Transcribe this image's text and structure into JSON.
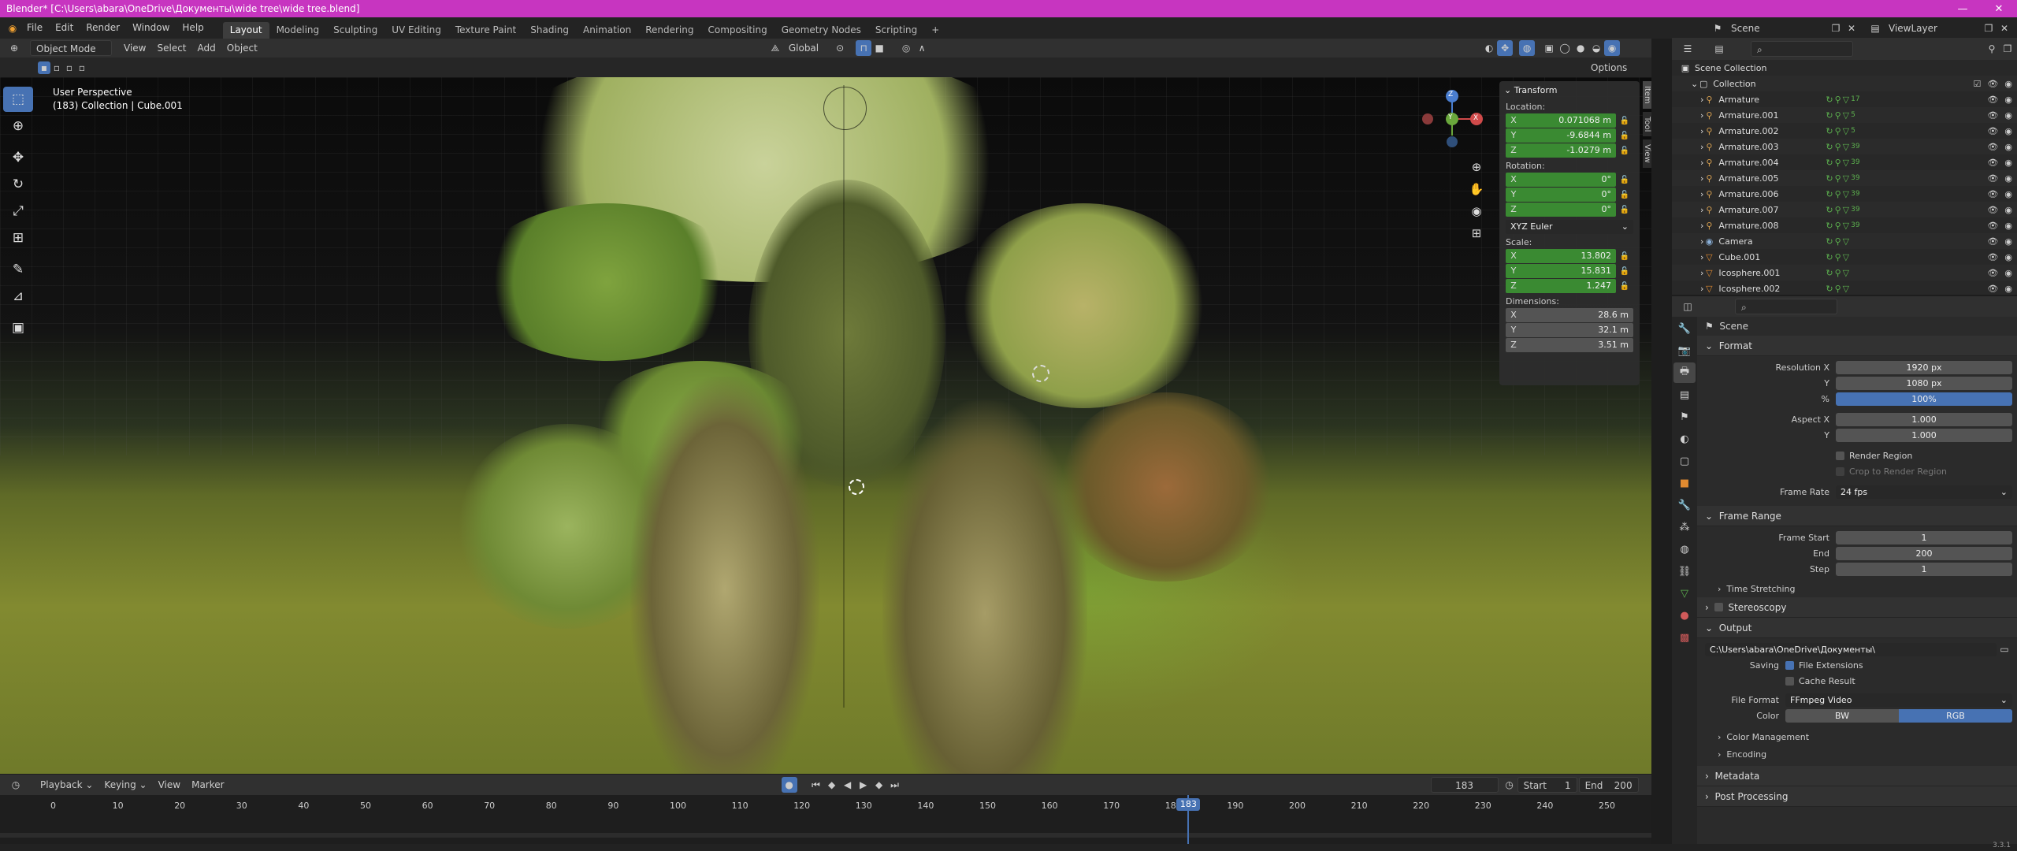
{
  "window": {
    "title": "Blender* [C:\\Users\\abara\\OneDrive\\Документы\\wide tree\\wide tree.blend]",
    "minimize": "—",
    "maximize": "❐",
    "close": "✕"
  },
  "menu": {
    "items": [
      "File",
      "Edit",
      "Render",
      "Window",
      "Help"
    ],
    "workspaces": [
      "Layout",
      "Modeling",
      "Sculpting",
      "UV Editing",
      "Texture Paint",
      "Shading",
      "Animation",
      "Rendering",
      "Compositing",
      "Geometry Nodes",
      "Scripting"
    ],
    "active_workspace": "Layout",
    "add_tab": "+"
  },
  "scene_selector": {
    "scene": "Scene",
    "view_layer": "ViewLayer"
  },
  "viewport_header": {
    "mode": "Object Mode",
    "menus": [
      "View",
      "Select",
      "Add",
      "Object"
    ],
    "orientation": "Global",
    "options": "Options"
  },
  "viewport": {
    "perspective": "User Perspective",
    "context": "(183) Collection | Cube.001"
  },
  "gizmo": {
    "x": "X",
    "y": "Y",
    "z": "Z"
  },
  "npanel": {
    "header": "Transform",
    "location_label": "Location:",
    "location": [
      {
        "axis": "X",
        "value": "0.071068 m"
      },
      {
        "axis": "Y",
        "value": "-9.6844 m"
      },
      {
        "axis": "Z",
        "value": "-1.0279 m"
      }
    ],
    "rotation_label": "Rotation:",
    "rotation": [
      {
        "axis": "X",
        "value": "0°"
      },
      {
        "axis": "Y",
        "value": "0°"
      },
      {
        "axis": "Z",
        "value": "0°"
      }
    ],
    "rotation_mode": "XYZ Euler",
    "scale_label": "Scale:",
    "scale": [
      {
        "axis": "X",
        "value": "13.802"
      },
      {
        "axis": "Y",
        "value": "15.831"
      },
      {
        "axis": "Z",
        "value": "1.247"
      }
    ],
    "dimensions_label": "Dimensions:",
    "dimensions": [
      {
        "axis": "X",
        "value": "28.6 m"
      },
      {
        "axis": "Y",
        "value": "32.1 m"
      },
      {
        "axis": "Z",
        "value": "3.51 m"
      }
    ],
    "tabs": [
      "Item",
      "Tool",
      "View"
    ]
  },
  "timeline": {
    "menus": [
      "Playback",
      "Keying",
      "View",
      "Marker"
    ],
    "current_frame": "183",
    "start_label": "Start",
    "start": "1",
    "end_label": "End",
    "end": "200",
    "ticks": [
      "0",
      "10",
      "20",
      "30",
      "40",
      "50",
      "60",
      "70",
      "80",
      "90",
      "100",
      "110",
      "120",
      "130",
      "140",
      "150",
      "160",
      "170",
      "180",
      "190",
      "200",
      "210",
      "220",
      "230",
      "240",
      "250"
    ],
    "playhead_frame": 183
  },
  "outliner": {
    "root": "Scene Collection",
    "collection": "Collection",
    "rows": [
      {
        "name": "Armature",
        "icon": "armature",
        "count": "17"
      },
      {
        "name": "Armature.001",
        "icon": "armature",
        "count": "5"
      },
      {
        "name": "Armature.002",
        "icon": "armature",
        "count": "5"
      },
      {
        "name": "Armature.003",
        "icon": "armature",
        "count": "39"
      },
      {
        "name": "Armature.004",
        "icon": "armature",
        "count": "39"
      },
      {
        "name": "Armature.005",
        "icon": "armature",
        "count": "39"
      },
      {
        "name": "Armature.006",
        "icon": "armature",
        "count": "39"
      },
      {
        "name": "Armature.007",
        "icon": "armature",
        "count": "39"
      },
      {
        "name": "Armature.008",
        "icon": "armature",
        "count": "39"
      },
      {
        "name": "Camera",
        "icon": "camera",
        "count": ""
      },
      {
        "name": "Cube.001",
        "icon": "mesh",
        "count": ""
      },
      {
        "name": "Icosphere.001",
        "icon": "mesh",
        "count": ""
      },
      {
        "name": "Icosphere.002",
        "icon": "mesh",
        "count": ""
      }
    ]
  },
  "properties": {
    "context": "Scene",
    "format": {
      "header": "Format",
      "res_x_label": "Resolution X",
      "res_x": "1920 px",
      "res_y_label": "Y",
      "res_y": "1080 px",
      "pct_label": "%",
      "pct": "100%",
      "aspect_x_label": "Aspect X",
      "aspect_x": "1.000",
      "aspect_y_label": "Y",
      "aspect_y": "1.000",
      "render_region": "Render Region",
      "crop": "Crop to Render Region",
      "frame_rate_label": "Frame Rate",
      "frame_rate": "24 fps"
    },
    "frame_range": {
      "header": "Frame Range",
      "start_label": "Frame Start",
      "start": "1",
      "end_label": "End",
      "end": "200",
      "step_label": "Step",
      "step": "1",
      "time_stretching": "Time Stretching"
    },
    "stereoscopy": "Stereoscopy",
    "output": {
      "header": "Output",
      "path": "C:\\Users\\abara\\OneDrive\\Документы\\",
      "saving_label": "Saving",
      "file_extensions": "File Extensions",
      "cache_result": "Cache Result",
      "file_format_label": "File Format",
      "file_format": "FFmpeg Video",
      "color_label": "Color",
      "color_bw": "BW",
      "color_rgb": "RGB",
      "color_management": "Color Management",
      "encoding": "Encoding"
    },
    "metadata": "Metadata",
    "post_processing": "Post Processing"
  },
  "version": "3.3.1",
  "colors": {
    "accent": "#4772b3",
    "title_bar": "#c735c0",
    "field_green": "#3a8a32"
  }
}
